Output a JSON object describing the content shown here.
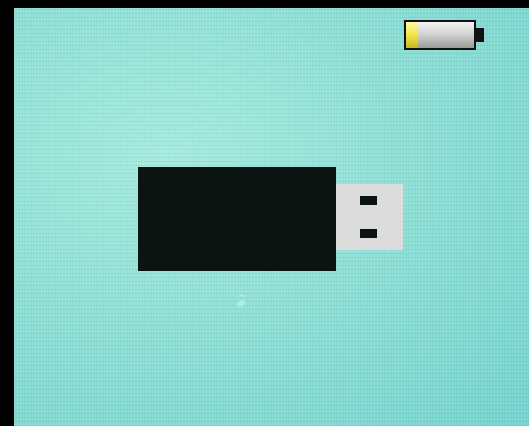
{
  "device_screen": {
    "background_color": "#8fe0d6",
    "battery": {
      "icon": "battery-icon",
      "charge_fraction": 0.18,
      "fill_color": "#f2e44a",
      "body_color": "#d8d8d8",
      "outline_color": "#111111"
    },
    "usb_device": {
      "icon": "usb-drive-icon",
      "body_color": "#0b1411",
      "connector_color": "#dcdcdc"
    }
  }
}
